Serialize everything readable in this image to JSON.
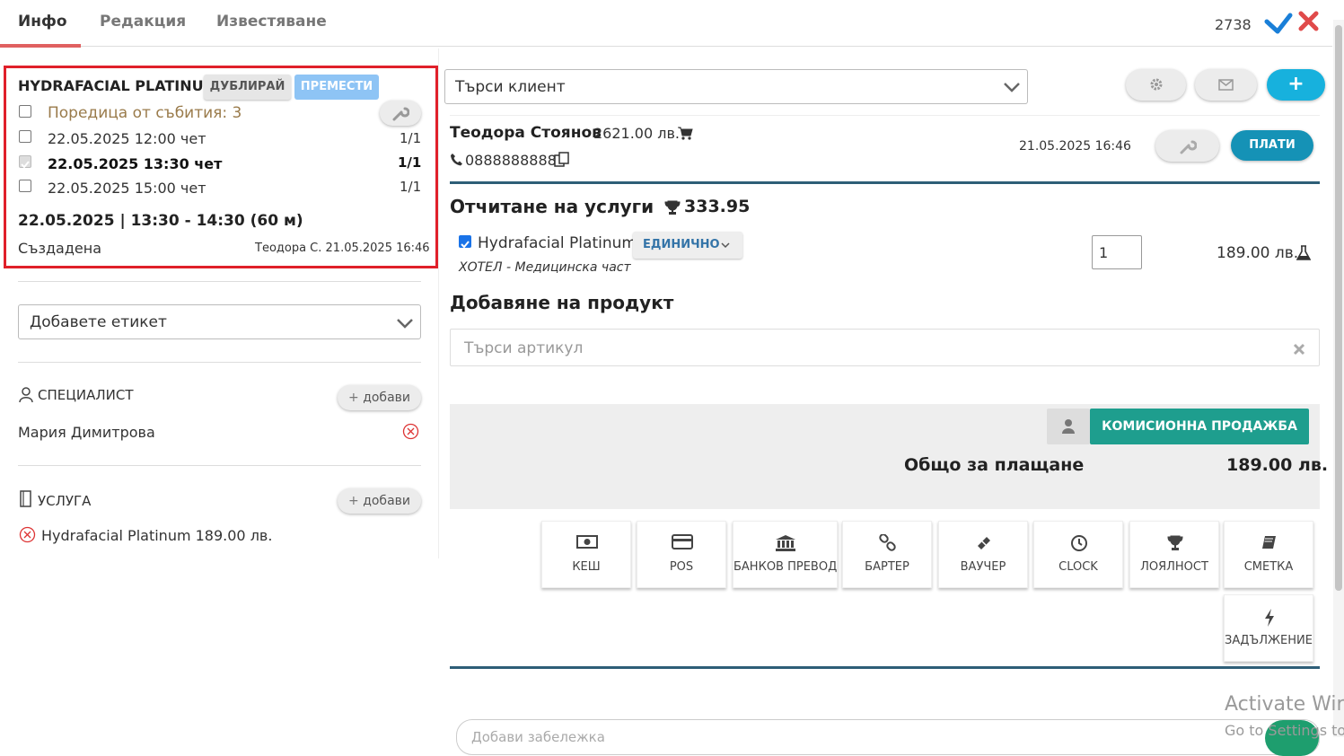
{
  "tabs": [
    {
      "label": "Инфо"
    },
    {
      "label": "Редакция"
    },
    {
      "label": "Известяване"
    }
  ],
  "ticket_id": "2738",
  "header_icons": {
    "confirm": "check-icon",
    "close": "close-icon",
    "confirm_color": "#1a7fd8",
    "close_color": "#e04a4a"
  },
  "booking": {
    "service_title": "HYDRAFACIAL PLATINUM",
    "duplicate_label": "ДУБЛИРАЙ",
    "move_label": "ПРЕМЕСТИ",
    "series_label": "Поредица от събития: 3",
    "events": [
      {
        "label": "22.05.2025 12:00 чет",
        "count": "1/1",
        "checked": false
      },
      {
        "label": "22.05.2025 13:30 чет",
        "count": "1/1",
        "checked": true
      },
      {
        "label": "22.05.2025 15:00 чет",
        "count": "1/1",
        "checked": false
      }
    ],
    "date_time": "22.05.2025 | 13:30 - 14:30 (60 м)",
    "status": "Създадена",
    "created_by": "Теодора С. 21.05.2025 16:46"
  },
  "tag_select": {
    "placeholder": "Добавете етикет"
  },
  "specialist": {
    "heading": "СПЕЦИАЛИСТ",
    "add_label": "добави",
    "name": "Мария Димитрова"
  },
  "service": {
    "heading": "УСЛУГА",
    "add_label": "добави",
    "item": "Hydrafacial Platinum 189.00 лв."
  },
  "client_search": {
    "placeholder": "Търси клиент"
  },
  "client": {
    "name": "Теодора Стоянов",
    "balance": "2621.00 лв.",
    "phone": "0888888888",
    "date": "21.05.2025 16:46",
    "pay_label": "ПЛАТИ"
  },
  "services_section": {
    "heading": "Отчитане на услуги",
    "points": "333.95",
    "item_name": "Hydrafacial Platinum",
    "item_mode": "ЕДИНИЧНО",
    "item_sub": "ХОТЕЛ - Медицинска част",
    "quantity": "1",
    "price": "189.00 лв."
  },
  "product_section": {
    "heading": "Добавяне на продукт",
    "search_placeholder": "Търси артикул"
  },
  "summary": {
    "commission_label": "КОМИСИОННА ПРОДАЖБА",
    "total_label": "Общо за плащане",
    "total_value": "189.00 лв."
  },
  "payment_methods": [
    {
      "label": "КЕШ",
      "icon": "cash-icon"
    },
    {
      "label": "POS",
      "icon": "card-icon"
    },
    {
      "label": "БАНКОВ ПРЕВОД",
      "icon": "bank-icon"
    },
    {
      "label": "БАРТЕР",
      "icon": "link-icon"
    },
    {
      "label": "ВАУЧЕР",
      "icon": "ticket-icon"
    },
    {
      "label": "CLOCK",
      "icon": "clock-icon"
    },
    {
      "label": "ЛОЯЛНОСТ",
      "icon": "trophy-icon"
    },
    {
      "label": "СМЕТКА",
      "icon": "book-icon"
    },
    {
      "label": "ЗАДЪЛЖЕНИЕ",
      "icon": "bolt-icon"
    }
  ],
  "note_placeholder": "Добави забележка",
  "watermark": {
    "line1": "Activate Wir",
    "line2": "Go to Settings to"
  }
}
